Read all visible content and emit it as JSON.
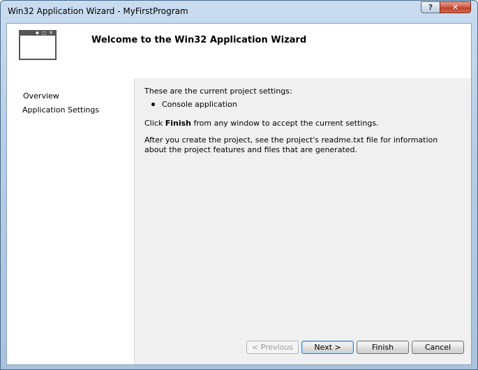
{
  "window": {
    "title": "Win32 Application Wizard - MyFirstProgram",
    "help_label": "?",
    "close_label": "✕"
  },
  "header": {
    "title": "Welcome to the Win32 Application Wizard",
    "icon_dots": "▪ ◻ ✕"
  },
  "nav": {
    "items": [
      {
        "label": "Overview"
      },
      {
        "label": "Application Settings"
      }
    ]
  },
  "content": {
    "intro": "These are the current project settings:",
    "bullet": "Console application",
    "finish_prefix": "Click ",
    "finish_bold": "Finish",
    "finish_suffix": " from any window to accept the current settings.",
    "readme": "After you create the project, see the project's readme.txt file for information about the project features and files that are generated."
  },
  "buttons": {
    "previous": "< Previous",
    "next": "Next >",
    "finish": "Finish",
    "cancel": "Cancel"
  }
}
